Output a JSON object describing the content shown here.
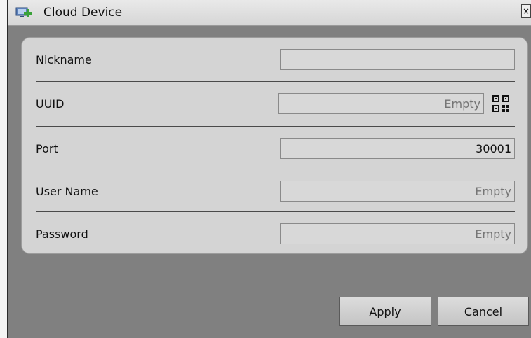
{
  "window": {
    "title": "Cloud Device",
    "close_glyph": "×",
    "icon": "add-device-icon"
  },
  "form": {
    "fields": [
      {
        "label": "Nickname",
        "value": "",
        "placeholder": ""
      },
      {
        "label": "UUID",
        "value": "",
        "placeholder": "Empty"
      },
      {
        "label": "Port",
        "value": "30001",
        "placeholder": ""
      },
      {
        "label": "User Name",
        "value": "",
        "placeholder": "Empty"
      },
      {
        "label": "Password",
        "value": "",
        "placeholder": "Empty"
      }
    ],
    "qr_icon": "qr-code-icon"
  },
  "buttons": {
    "apply": "Apply",
    "cancel": "Cancel"
  },
  "colors": {
    "background": "#808080",
    "panel": "#d4d4d4",
    "accent_green": "#3aa23a"
  }
}
